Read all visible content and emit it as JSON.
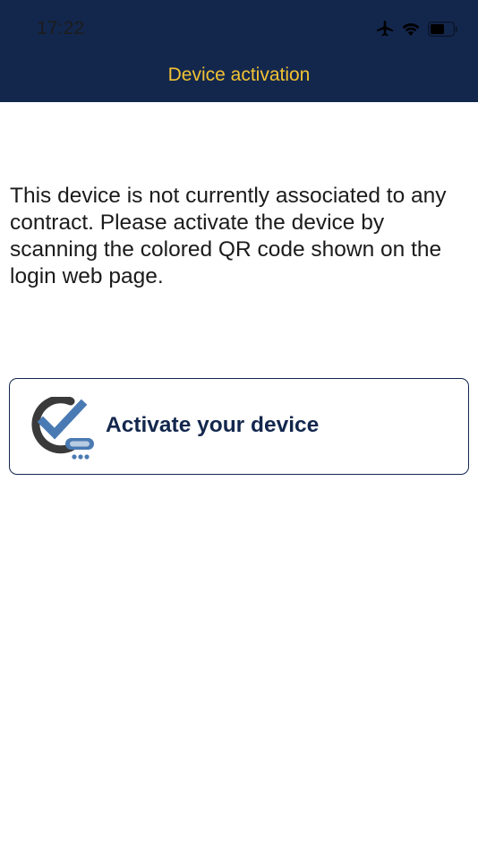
{
  "status_bar": {
    "time": "17:22",
    "icons": [
      "airplane-icon",
      "wifi-icon",
      "battery-icon"
    ]
  },
  "header": {
    "title": "Device activation"
  },
  "main": {
    "message": "This device is not currently associated to any contract. Please activate the device by scanning the colored QR code shown on the login web page.",
    "activate_button": {
      "label": "Activate your device",
      "icon": "activation-check-icon"
    }
  },
  "colors": {
    "nav_background": "#13274d",
    "title_text": "#f2c232",
    "button_border": "#13274d",
    "check_blue": "#4a7ab3"
  }
}
